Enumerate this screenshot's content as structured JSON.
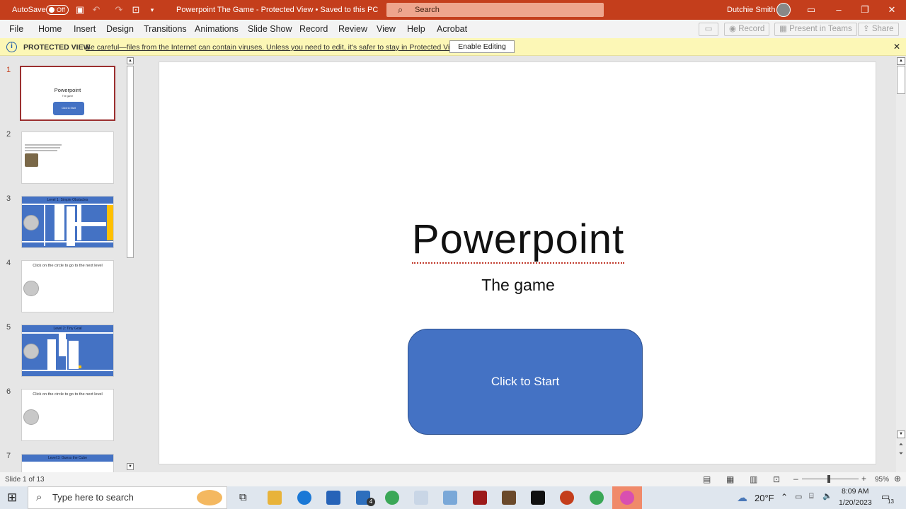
{
  "titlebar": {
    "autosave_label": "AutoSave",
    "autosave_state": "Off",
    "doc_title": "Powerpoint The Game  -  Protected View • Saved to this PC",
    "search_placeholder": "Search",
    "user_name": "Dutchie Smith"
  },
  "ribbon": {
    "tabs": [
      "File",
      "Home",
      "Insert",
      "Design",
      "Transitions",
      "Animations",
      "Slide Show",
      "Record",
      "Review",
      "View",
      "Help",
      "Acrobat"
    ],
    "record_label": "Record",
    "present_label": "Present in Teams",
    "share_label": "Share"
  },
  "protected": {
    "label": "PROTECTED VIEW",
    "message": "Be careful—files from the Internet can contain viruses. Unless you need to edit, it's safer to stay in Protected View.",
    "enable_label": "Enable Editing"
  },
  "slides_panel": {
    "numbers": [
      "1",
      "2",
      "3",
      "4",
      "5",
      "6",
      "7"
    ],
    "thumb1": {
      "title": "Powerpoint",
      "sub": "The game",
      "button": "Click to Start"
    },
    "thumb3_title": "Level 1: Simple Obstacles",
    "thumb4_caption": "Click on the circle to go to the next level",
    "thumb5_title": "Level 2: Tiny Goal",
    "thumb6_caption": "Click on the circle to go to the next level",
    "thumb7_title": "Level 3: Guess the Cube"
  },
  "slide": {
    "title": "Powerpoint",
    "subtitle": "The game",
    "button_label": "Click to Start"
  },
  "status": {
    "slide_count": "Slide 1 of 13",
    "zoom": "95%"
  },
  "taskbar": {
    "search_placeholder": "Type here to search",
    "mail_badge": "4",
    "weather": "20°F",
    "time": "8:09 AM",
    "date": "1/20/2023",
    "notifications": "13"
  },
  "colors": {
    "titlebar": "#c43e1c",
    "accent_blue": "#4472c4",
    "protected_bg": "#fcf7b6"
  }
}
